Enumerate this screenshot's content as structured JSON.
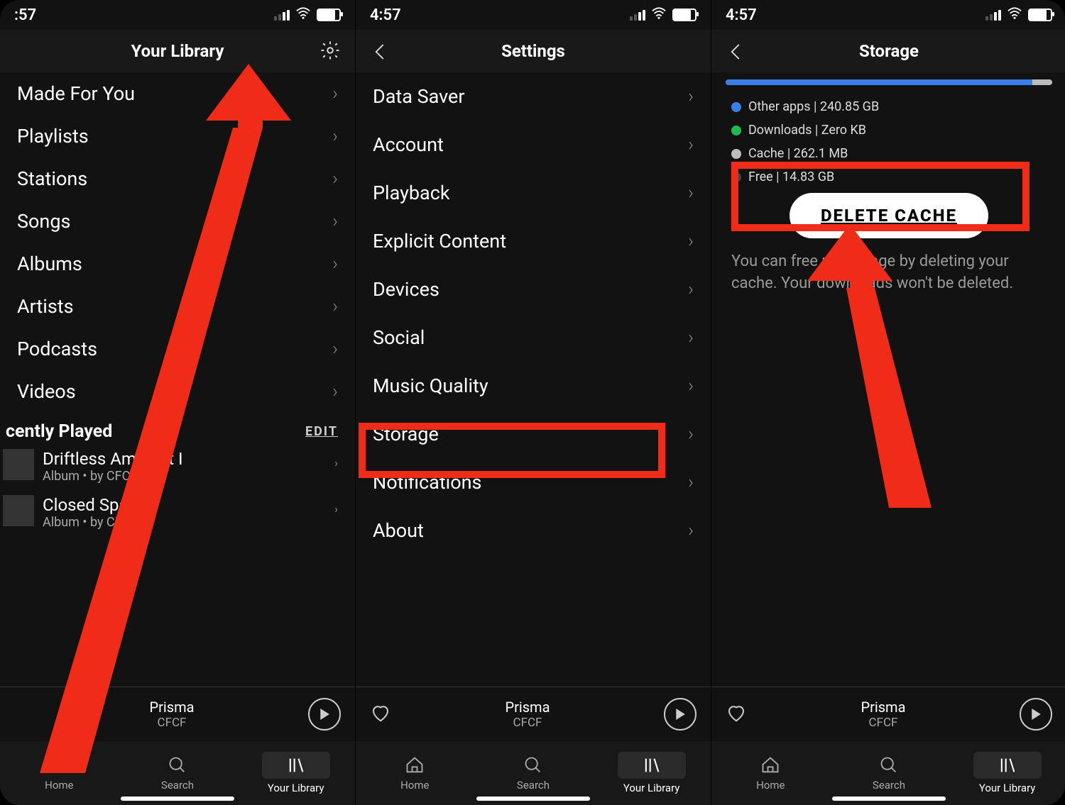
{
  "time1": ":57",
  "time2": "4:57",
  "time3": "4:57",
  "screen1": {
    "title": "Your Library",
    "categories": [
      "Made For You",
      "Playlists",
      "Stations",
      "Songs",
      "Albums",
      "Artists",
      "Podcasts",
      "Videos"
    ],
    "recently_label": "cently Played",
    "edit": "EDIT",
    "recent": [
      {
        "title": "Driftless Ambient I",
        "sub": "Album • by CFCF"
      },
      {
        "title": "Closed Space",
        "sub": "Album • by CFCF"
      }
    ]
  },
  "screen2": {
    "title": "Settings",
    "items": [
      "Data Saver",
      "Account",
      "Playback",
      "Explicit Content",
      "Devices",
      "Social",
      "Music Quality",
      "Storage",
      "Notifications",
      "About"
    ]
  },
  "screen3": {
    "title": "Storage",
    "legend": [
      {
        "color": "#3a7eea",
        "text": "Other apps | 240.85 GB"
      },
      {
        "color": "#1db954",
        "text": "Downloads | Zero KB"
      },
      {
        "color": "#bdbdbd",
        "text": "Cache | 262.1 MB"
      },
      {
        "color": "#444",
        "text": "Free | 14.83 GB"
      }
    ],
    "button": "DELETE CACHE",
    "desc": "You can free up storage by deleting your cache. Your downloads won't be deleted."
  },
  "now_playing": {
    "song": "Prisma",
    "artist": "CFCF"
  },
  "tabs": {
    "home": "Home",
    "search": "Search",
    "library": "Your Library"
  }
}
